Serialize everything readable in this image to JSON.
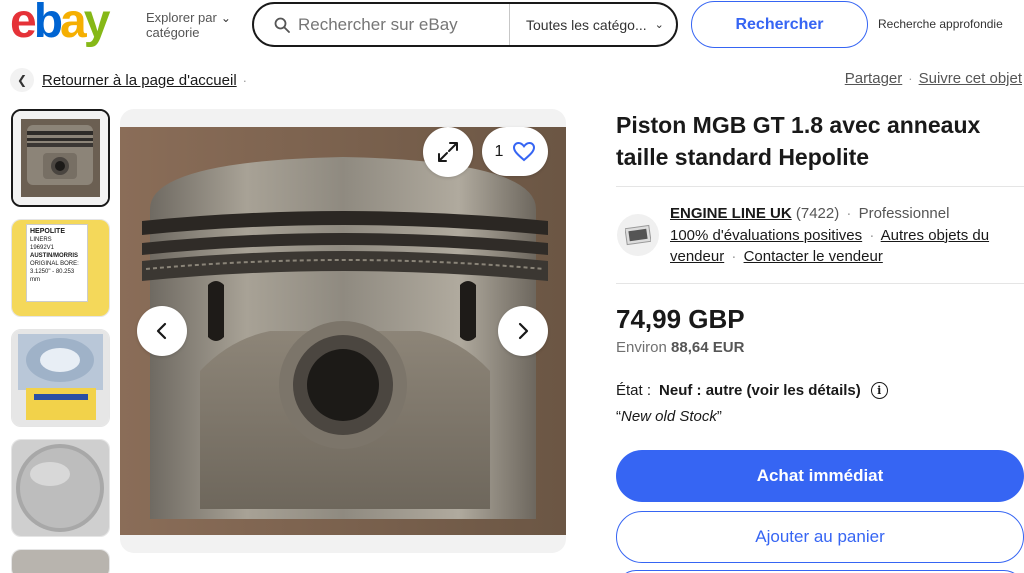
{
  "header": {
    "logo": {
      "e": "e",
      "b": "b",
      "a": "a",
      "y": "y"
    },
    "explore_line1": "Explorer par",
    "explore_line2": "catégorie",
    "search_placeholder": "Rechercher sur eBay",
    "category_select": "Toutes les catégo...",
    "search_button": "Rechercher",
    "advanced_link": "Recherche approfondie"
  },
  "nav": {
    "back_link": "Retourner à la page d'accueil",
    "share": "Partager",
    "follow": "Suivre cet objet"
  },
  "gallery": {
    "favorite_count": "1",
    "thumbnails": [
      {
        "name": "piston-side",
        "selected": true
      },
      {
        "name": "hepolite-box-label",
        "selected": false
      },
      {
        "name": "hepolite-box-open",
        "selected": false
      },
      {
        "name": "piston-top",
        "selected": false
      }
    ],
    "box_label": {
      "brand": "HEPOLITE",
      "line1": "LINERS",
      "line2": "19692V1",
      "maker": "AUSTIN/MORRIS",
      "bore": "ORIGINAL BORE:",
      "bore_value": "3.1250\" - 80.253 mm"
    }
  },
  "item": {
    "title": "Piston MGB GT 1.8 avec anneaux taille standard Hepolite",
    "seller": {
      "name": "ENGINE LINE UK",
      "feedback": "(7422)",
      "type": "Professionnel",
      "positive": "100% d'évaluations positives",
      "other_items": "Autres objets du vendeur",
      "contact": "Contacter le vendeur"
    },
    "price": "74,99 GBP",
    "approx_label": "Environ",
    "approx_value": "88,64 EUR",
    "condition_label": "État :",
    "condition_value": "Neuf : autre (voir les détails)",
    "condition_note": "New old Stock",
    "buy_now": "Achat immédiat",
    "add_to_cart": "Ajouter au panier"
  },
  "colors": {
    "accent": "#3665f3",
    "ebay_red": "#e53238",
    "ebay_blue": "#0064d2",
    "ebay_yellow": "#f5af02",
    "ebay_green": "#86b817"
  }
}
